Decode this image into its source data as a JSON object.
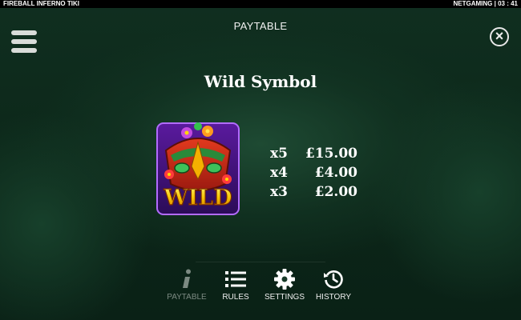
{
  "topbar": {
    "game_name": "FIREBALL INFERNO TIKI",
    "status": "NETGAMING | 03 : 41"
  },
  "header": {
    "title": "PAYTABLE"
  },
  "symbol": {
    "heading": "Wild Symbol",
    "label": "WILD"
  },
  "pays": [
    {
      "count": "x5",
      "amount": "£15.00"
    },
    {
      "count": "x4",
      "amount": "£4.00"
    },
    {
      "count": "x3",
      "amount": "£2.00"
    }
  ],
  "nav": [
    {
      "label": "PAYTABLE",
      "icon": "info-icon",
      "active": true
    },
    {
      "label": "RULES",
      "icon": "list-icon"
    },
    {
      "label": "SETTINGS",
      "icon": "gear-icon"
    },
    {
      "label": "HISTORY",
      "icon": "history-icon"
    }
  ],
  "colors": {
    "accent_text": "#ffffff",
    "inactive_nav": "#7c8a82",
    "wild_gold": "#f5c400",
    "wild_purple": "#8a2be2"
  }
}
